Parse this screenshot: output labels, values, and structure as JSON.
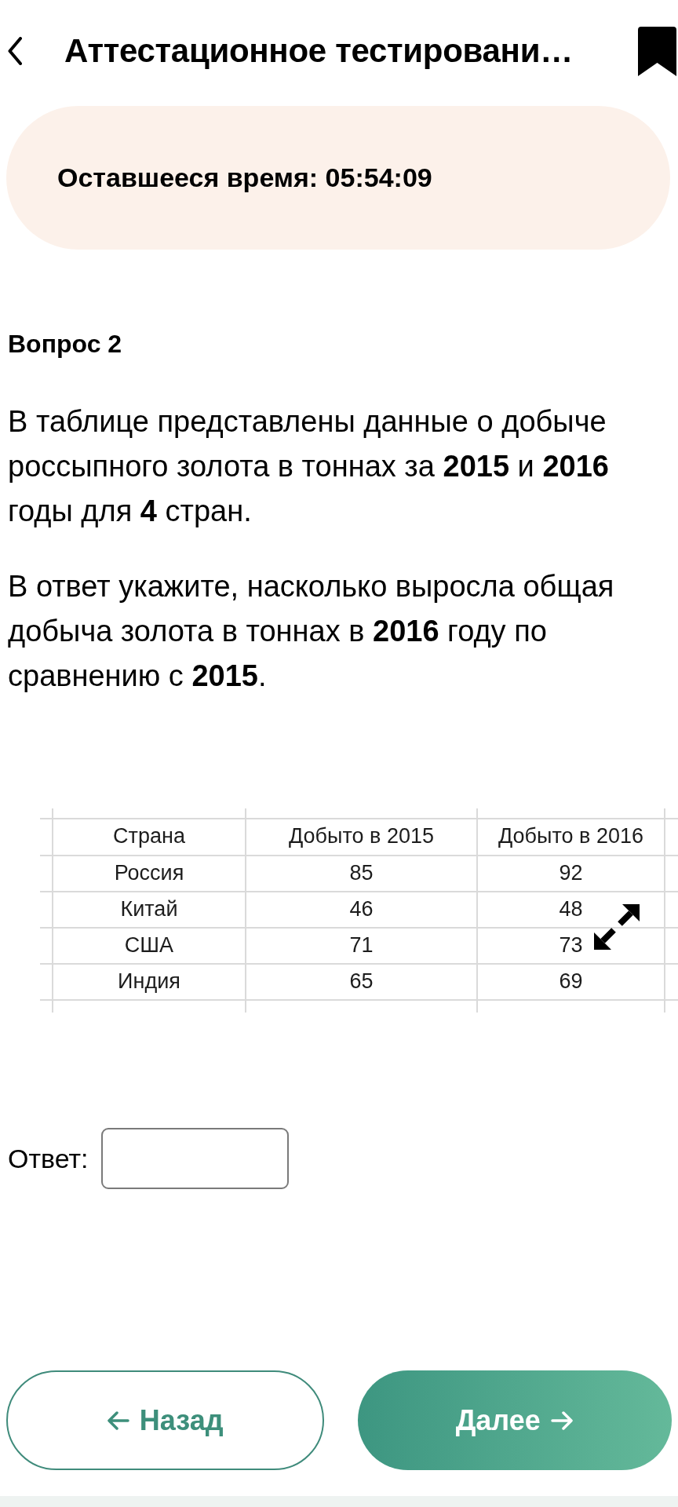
{
  "header": {
    "title": "Аттестационное тестировани…"
  },
  "timer": {
    "text": "Оставшееся время: 05:54:09"
  },
  "question": {
    "title": "Вопрос 2",
    "paragraphs": [
      "В таблице представлены данные о добыче россыпного золота в тоннах за **2015** и **2016** годы для **4** стран.",
      "В ответ укажите, насколько выросла общая добыча золота в тоннах в **2016** году по сравнению с **2015**."
    ],
    "table": {
      "columns": [
        "Страна",
        "Добыто в 2015",
        "Добыто в 2016"
      ],
      "rows": [
        [
          "Россия",
          "85",
          "92"
        ],
        [
          "Китай",
          "46",
          "48"
        ],
        [
          "США",
          "71",
          "73"
        ],
        [
          "Индия",
          "65",
          "69"
        ]
      ]
    }
  },
  "answer": {
    "label": "Ответ:"
  },
  "buttons": [
    {
      "label": "Назад",
      "kind": "back"
    },
    {
      "label": "Далее",
      "kind": "next"
    }
  ]
}
